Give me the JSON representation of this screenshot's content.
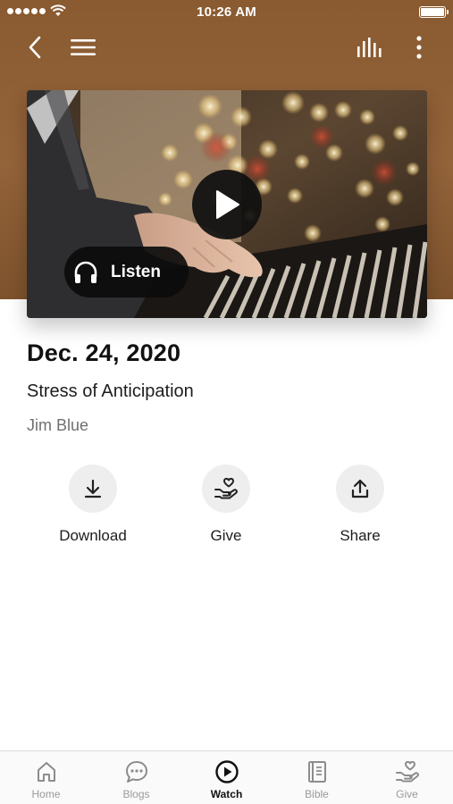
{
  "status_bar": {
    "time": "10:26 AM"
  },
  "nav": {
    "back_icon": "chevron-left-icon",
    "menu_icon": "hamburger-menu-icon",
    "audio_icon": "equalizer-icon",
    "more_icon": "vertical-dots-icon"
  },
  "media": {
    "play_icon": "play-icon",
    "listen_label": "Listen",
    "listen_icon": "headphones-icon"
  },
  "sermon": {
    "date": "Dec. 24, 2020",
    "title": "Stress of Anticipation",
    "speaker": "Jim Blue"
  },
  "actions": [
    {
      "label": "Download",
      "icon": "download-icon"
    },
    {
      "label": "Give",
      "icon": "hand-heart-icon"
    },
    {
      "label": "Share",
      "icon": "share-icon"
    }
  ],
  "tabs": [
    {
      "label": "Home",
      "icon": "home-icon",
      "active": false
    },
    {
      "label": "Blogs",
      "icon": "chat-bubble-icon",
      "active": false
    },
    {
      "label": "Watch",
      "icon": "play-circle-icon",
      "active": true
    },
    {
      "label": "Bible",
      "icon": "book-icon",
      "active": false
    },
    {
      "label": "Give",
      "icon": "hand-heart-icon",
      "active": false
    }
  ],
  "colors": {
    "header_brown": "#8a5a30",
    "active_tab": "#111111",
    "inactive_tab": "#9a9a9a",
    "action_circle": "#eeeeee"
  }
}
